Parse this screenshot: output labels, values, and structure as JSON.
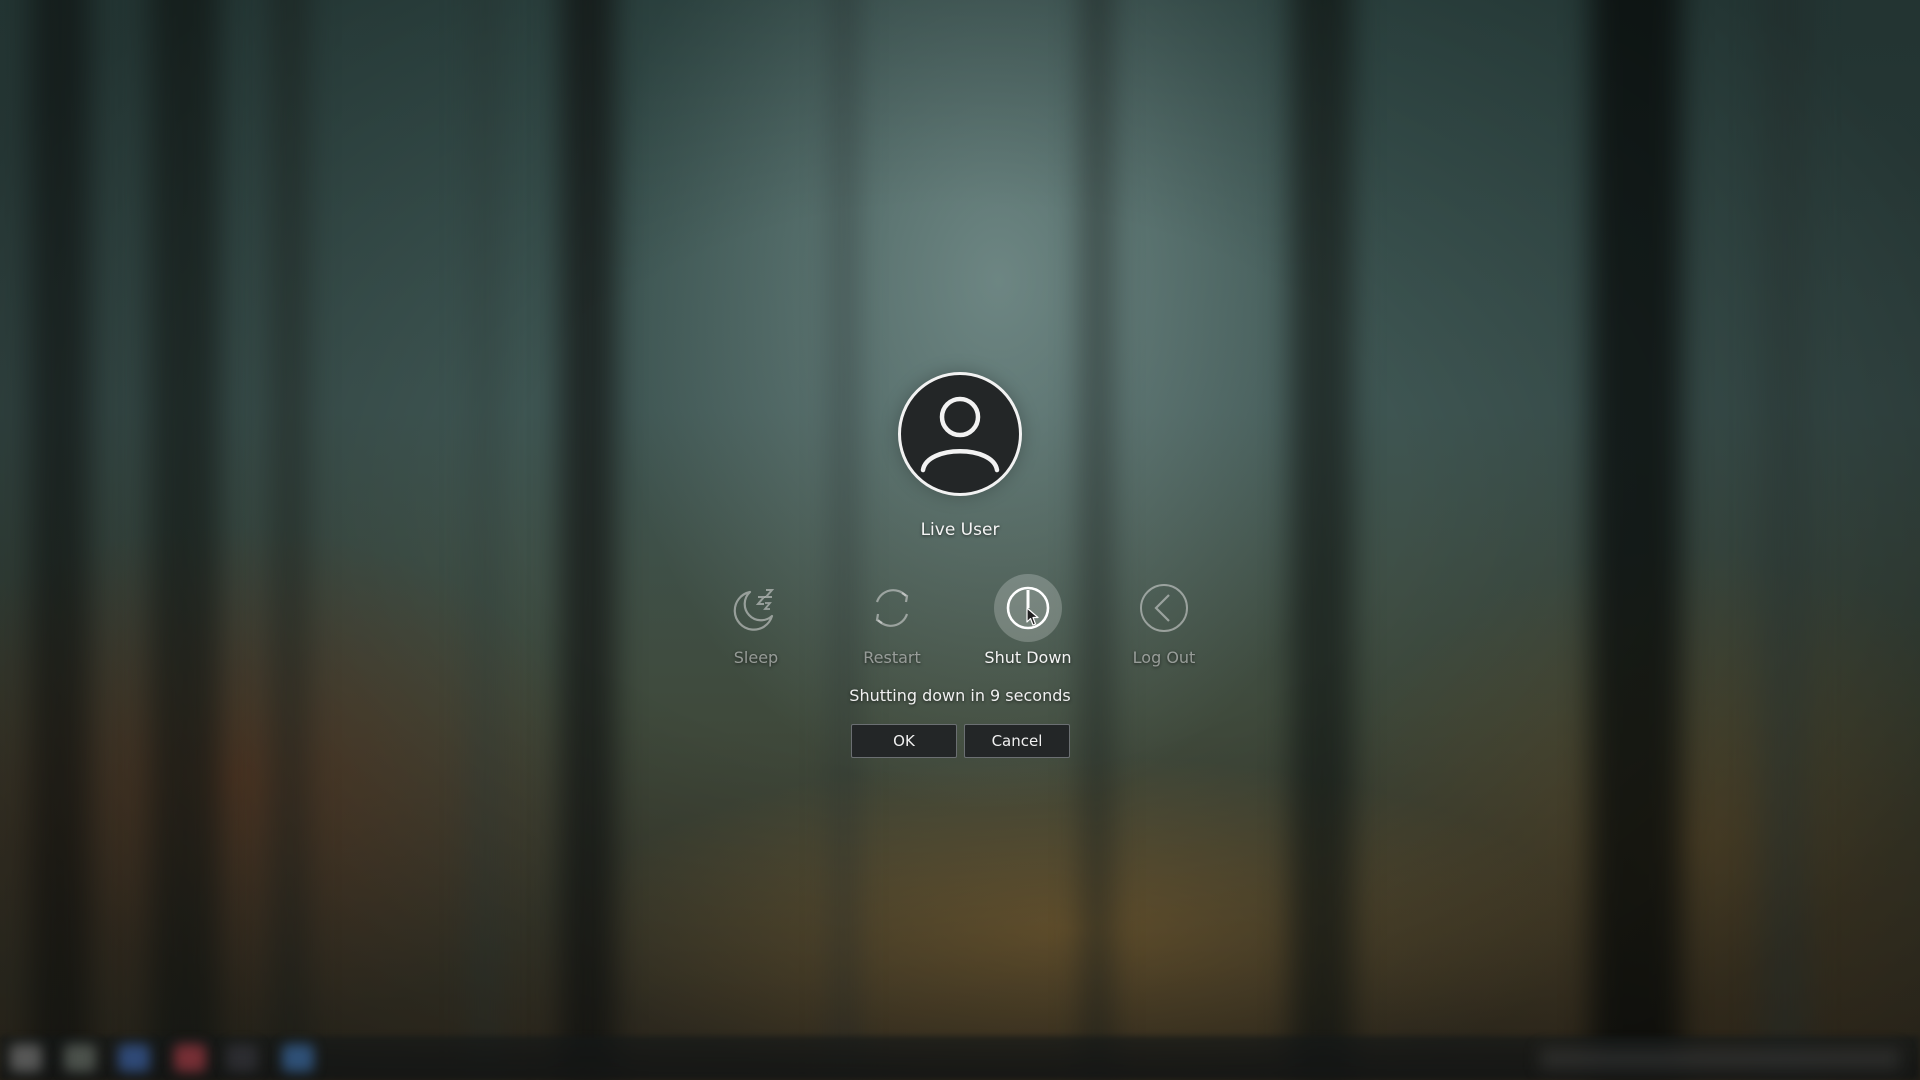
{
  "user": {
    "name": "Live User",
    "avatar_icon": "user-avatar-icon"
  },
  "actions": [
    {
      "id": "sleep",
      "label": "Sleep",
      "icon": "sleep-icon",
      "active": false
    },
    {
      "id": "restart",
      "label": "Restart",
      "icon": "restart-icon",
      "active": false
    },
    {
      "id": "shutdown",
      "label": "Shut Down",
      "icon": "power-icon",
      "active": true
    },
    {
      "id": "logout",
      "label": "Log Out",
      "icon": "logout-icon",
      "active": false
    }
  ],
  "countdown": {
    "text": "Shutting down in 9 seconds"
  },
  "buttons": {
    "ok_label": "OK",
    "cancel_label": "Cancel"
  },
  "colors": {
    "dialog_button_bg": "#232627",
    "text": "#f4f4f4",
    "inactive_text": "rgba(230,230,230,0.55)"
  }
}
